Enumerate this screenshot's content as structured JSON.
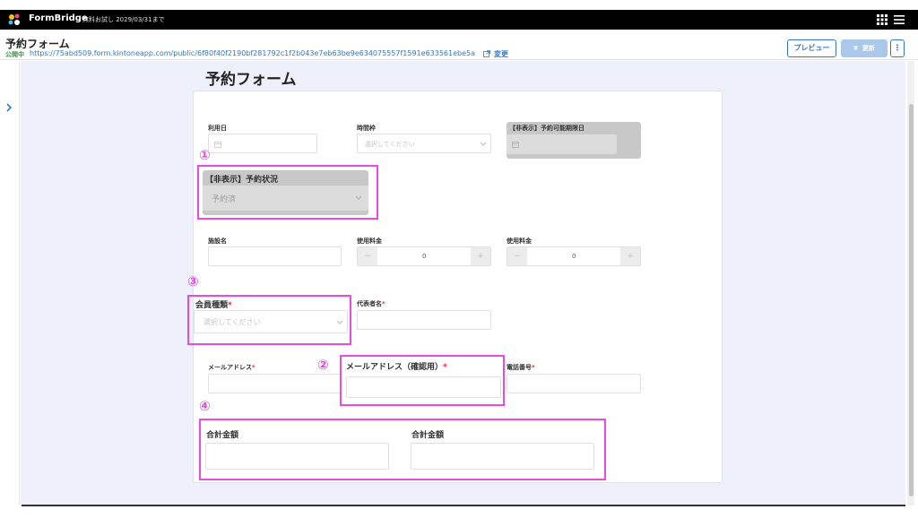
{
  "topbar": {
    "app_name": "FormBridge",
    "trial_text": "無料お試し 2029/03/31まで",
    "icons": [
      "formbridge-logo-icon",
      "grid-icon",
      "menu-icon"
    ]
  },
  "header": {
    "title": "予約フォーム",
    "status": "公開中",
    "url": "https://75abd509.form.kintoneapp.com/public/6f80f40f2190bf281792c1f2b043e7eb63be9e634075557f1591e633561ebe5a",
    "change_label": "変更",
    "preview_label": "プレビュー",
    "update_label": "更新",
    "update_icon": "¥",
    "more_label": "⋮"
  },
  "form": {
    "heading": "予約フォーム",
    "fields": {
      "use_date": {
        "label": "利用日"
      },
      "time_slot": {
        "label": "時間枠",
        "placeholder": "選択してください"
      },
      "hidden_deadline": {
        "label": "【非表示】予約可能期限日"
      },
      "hidden_status": {
        "label": "【非表示】予約状況",
        "value": "予約済"
      },
      "facility": {
        "label": "施設名"
      },
      "fee1": {
        "label": "使用料金",
        "value": "0",
        "minus": "−",
        "plus": "+"
      },
      "fee2": {
        "label": "使用料金",
        "value": "0",
        "minus": "−",
        "plus": "+"
      },
      "member_type": {
        "label": "会員種類",
        "required": "*",
        "placeholder": "選択してください"
      },
      "representative": {
        "label": "代表者名",
        "required": "*"
      },
      "email": {
        "label": "メールアドレス",
        "required": "*"
      },
      "email_confirm": {
        "label": "メールアドレス（確認用）",
        "required": "*"
      },
      "phone": {
        "label": "電話番号",
        "required": "*"
      },
      "total1": {
        "label": "合計金額"
      },
      "total2": {
        "label": "合計金額"
      }
    }
  },
  "annotations": {
    "n1": "①",
    "n2": "②",
    "n3": "③",
    "n4": "④",
    "color": "#e64ce0"
  },
  "colors": {
    "accent": "#3479c6",
    "status_green": "#2e9e3a",
    "canvas_bg": "#eef0fb",
    "required": "#ee2233"
  }
}
